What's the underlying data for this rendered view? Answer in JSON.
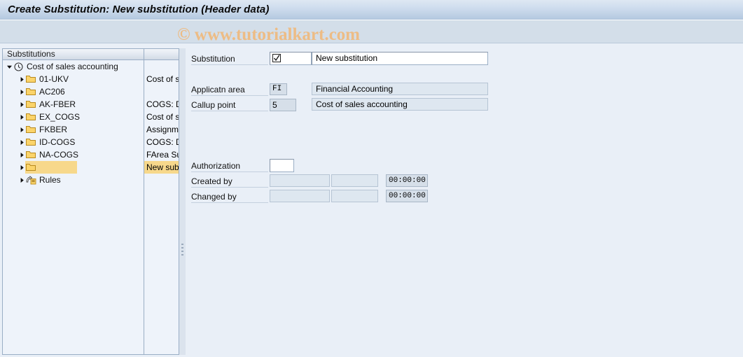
{
  "window": {
    "title": "Create Substitution: New substitution (Header data)"
  },
  "watermark": {
    "text": "© www.tutorialkart.com"
  },
  "tree": {
    "columns": [
      "Substitutions",
      ""
    ],
    "rows": [
      {
        "label": "Cost of sales accounting",
        "desc": "",
        "icon": "clock-icon",
        "indent": 0,
        "twisty": "down",
        "selected": false
      },
      {
        "label": "01-UKV",
        "desc": "Cost of sa",
        "icon": "folder-icon",
        "indent": 1,
        "twisty": "right",
        "selected": false
      },
      {
        "label": "AC206",
        "desc": "",
        "icon": "folder-icon",
        "indent": 1,
        "twisty": "right",
        "selected": false
      },
      {
        "label": "AK-FBER",
        "desc": "COGS: De",
        "icon": "folder-icon",
        "indent": 1,
        "twisty": "right",
        "selected": false
      },
      {
        "label": "EX_COGS",
        "desc": "Cost of sa",
        "icon": "folder-icon",
        "indent": 1,
        "twisty": "right",
        "selected": false
      },
      {
        "label": "FKBER",
        "desc": "Assignme",
        "icon": "folder-icon",
        "indent": 1,
        "twisty": "right",
        "selected": false
      },
      {
        "label": "ID-COGS",
        "desc": "COGS: De",
        "icon": "folder-icon",
        "indent": 1,
        "twisty": "right",
        "selected": false
      },
      {
        "label": "NA-COGS",
        "desc": "FArea Su",
        "icon": "folder-icon",
        "indent": 1,
        "twisty": "right",
        "selected": false
      },
      {
        "label": "",
        "desc": "New subs",
        "icon": "folder-icon",
        "indent": 1,
        "twisty": "right",
        "selected": true
      },
      {
        "label": "Rules",
        "desc": "",
        "icon": "rules-icon",
        "indent": 1,
        "twisty": "right",
        "selected": false
      }
    ]
  },
  "form": {
    "substitution": {
      "label": "Substitution",
      "key_value": "",
      "key_icon": "checkbox-checked-icon",
      "text_value": "New substitution"
    },
    "application_area": {
      "label": "Applicatn area",
      "code": "FI",
      "text": "Financial Accounting"
    },
    "callup_point": {
      "label": "Callup point",
      "code": "5",
      "text": "Cost of sales accounting"
    },
    "authorization": {
      "label": "Authorization",
      "value": ""
    },
    "created_by": {
      "label": "Created by",
      "user": "",
      "date": "",
      "time": "00:00:00"
    },
    "changed_by": {
      "label": "Changed by",
      "user": "",
      "date": "",
      "time": "00:00:00"
    }
  },
  "colors": {
    "title_gradient_top": "#dee8f3",
    "title_gradient_bottom": "#a8bdd6",
    "toolbar_bg": "#d3dee9",
    "page_bg": "#e9eff7",
    "tree_bg": "#eef3fa",
    "selection": "#f7d88b",
    "watermark": "#edbc85",
    "field_border": "#9aaec5",
    "readonly_field": "#dee7f0"
  }
}
